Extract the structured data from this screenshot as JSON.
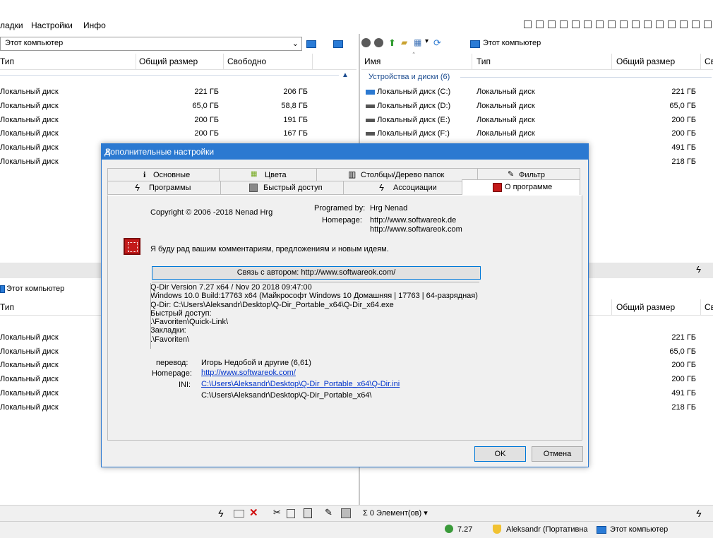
{
  "menu": {
    "items": [
      "ладки",
      "Настройки",
      "Инфо"
    ]
  },
  "left_pane_top": {
    "address": "Этот компьютер",
    "columns": [
      "Тип",
      "Общий размер",
      "Свободно"
    ],
    "rows": [
      {
        "type": "Локальный диск",
        "size": "221 ГБ",
        "free": "206 ГБ"
      },
      {
        "type": "Локальный диск",
        "size": "65,0 ГБ",
        "free": "58,8 ГБ"
      },
      {
        "type": "Локальный диск",
        "size": "200 ГБ",
        "free": "191 ГБ"
      },
      {
        "type": "Локальный диск",
        "size": "200 ГБ",
        "free": "167 ГБ"
      },
      {
        "type": "Локальный диск",
        "size": "",
        "free": ""
      },
      {
        "type": "Локальный диск",
        "size": "",
        "free": ""
      }
    ]
  },
  "right_pane_top": {
    "address": "Этот компьютер",
    "columns": [
      "Имя",
      "Тип",
      "Общий размер",
      "Св"
    ],
    "group": "Устройства и диски (6)",
    "rows": [
      {
        "name": "Локальный диск (C:)",
        "type": "Локальный диск",
        "size": "221 ГБ"
      },
      {
        "name": "Локальный диск (D:)",
        "type": "Локальный диск",
        "size": "65,0 ГБ"
      },
      {
        "name": "Локальный диск (E:)",
        "type": "Локальный диск",
        "size": "200 ГБ"
      },
      {
        "name": "Локальный диск (F:)",
        "type": "Локальный диск",
        "size": "200 ГБ"
      },
      {
        "name": "",
        "type": "",
        "size": "491 ГБ"
      },
      {
        "name": "",
        "type": "",
        "size": "218 ГБ"
      }
    ]
  },
  "left_pane_bottom": {
    "address": "Этот компьютер",
    "columns": [
      "Тип"
    ],
    "rows": [
      "Локальный диск",
      "Локальный диск",
      "Локальный диск",
      "Локальный диск",
      "Локальный диск",
      "Локальный диск"
    ]
  },
  "right_pane_bottom": {
    "columns": [
      "Общий размер",
      "Св"
    ],
    "sizes": [
      "221 ГБ",
      "65,0 ГБ",
      "200 ГБ",
      "200 ГБ",
      "491 ГБ",
      "218 ГБ"
    ]
  },
  "dialog": {
    "title": "Дополнительные настройки",
    "tabs_row1": [
      "Основные",
      "Цвета",
      "Столбцы/Дерево папок",
      "Фильтр"
    ],
    "tabs_row2": [
      "Программы",
      "Быстрый доступ",
      "Ассоциации",
      "О программе"
    ],
    "copyright": "Copyright © 2006 -2018 Nenad Hrg",
    "programmed_by_label": "Programed by:",
    "programmed_by_value": "Hrg Nenad",
    "homepage_label": "Homepage:",
    "homepage_1": "http://www.softwareok.de",
    "homepage_2": "http://www.softwareok.com",
    "comment": "Я буду рад вашим комментариям, предложениям и новым идеям.",
    "contact_button": "Связь с автором: http://www.softwareok.com/",
    "info_lines": [
      "Q-Dir Version 7.27  x64  /  Nov 20 2018 09:47:00",
      "Windows 10.0 Build:17763 x64 (Майкрософт Windows 10 Домашняя | 17763 | 64-разрядная)",
      "Q-Dir: C:\\Users\\Aleksandr\\Desktop\\Q-Dir_Portable_x64\\Q-Dir_x64.exe",
      "Быстрый доступ:",
      ".\\Favoriten\\Quick-Link\\",
      "Закладки:",
      ".\\Favoriten\\"
    ],
    "translation_label": "перевод:",
    "translation_value": "Игорь Недобой и другие (6,61)",
    "homepage2_label": "Homepage:",
    "homepage2_value": "http://www.softwareok.com/",
    "ini_label": "INI:",
    "ini_value": "C:\\Users\\Aleksandr\\Desktop\\Q-Dir_Portable_x64\\Q-Dir.ini",
    "ini_dir": "C:\\Users\\Aleksandr\\Desktop\\Q-Dir_Portable_x64\\",
    "ok": "OK",
    "cancel": "Отмена"
  },
  "status": {
    "elements": "Σ 0 Элемент(ов) ▾",
    "version": "7.27",
    "user": "Aleksandr (Портативна",
    "location": "Этот компьютер"
  },
  "colors": {
    "accent": "#2b79d1",
    "link": "#0033cc",
    "group": "#1b4b8f"
  }
}
